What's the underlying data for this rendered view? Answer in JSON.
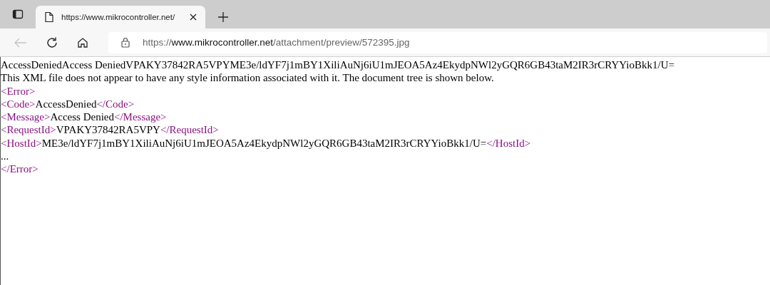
{
  "tab": {
    "title": "https://www.mikrocontroller.net/",
    "selected": true
  },
  "toolbar": {
    "back_disabled": true
  },
  "address": {
    "scheme": "https://",
    "host": "www.mikrocontroller.net",
    "path": "/attachment/preview/572395.jpg"
  },
  "content": {
    "raw_text": "AccessDeniedAccess DeniedVPAKY37842RA5VPYME3e/ldYF7j1mBY1XiliAuNj6iU1mJEOA5Az4EkydpNWl2yGQR6GB43taM2IR3rCRYYioBkk1/U=",
    "notice": "This XML file does not appear to have any style information associated with it. The document tree is shown below.",
    "xml_lines": [
      {
        "kind": "open",
        "open": "<Error>"
      },
      {
        "kind": "element",
        "open": "<Code>",
        "text": "AccessDenied",
        "close": "</Code>"
      },
      {
        "kind": "element",
        "open": "<Message>",
        "text": "Access Denied",
        "close": "</Message>"
      },
      {
        "kind": "element",
        "open": "<RequestId>",
        "text": "VPAKY37842RA5VPY",
        "close": "</RequestId>"
      },
      {
        "kind": "element",
        "open": "<HostId>",
        "text": "ME3e/ldYF7j1mBY1XiliAuNj6iU1mJEOA5Az4EkydpNWl2yGQR6GB43taM2IR3rCRYYioBkk1/U=",
        "close": "</HostId>"
      },
      {
        "kind": "text",
        "text": "..."
      },
      {
        "kind": "close",
        "close": "</Error>"
      }
    ]
  }
}
